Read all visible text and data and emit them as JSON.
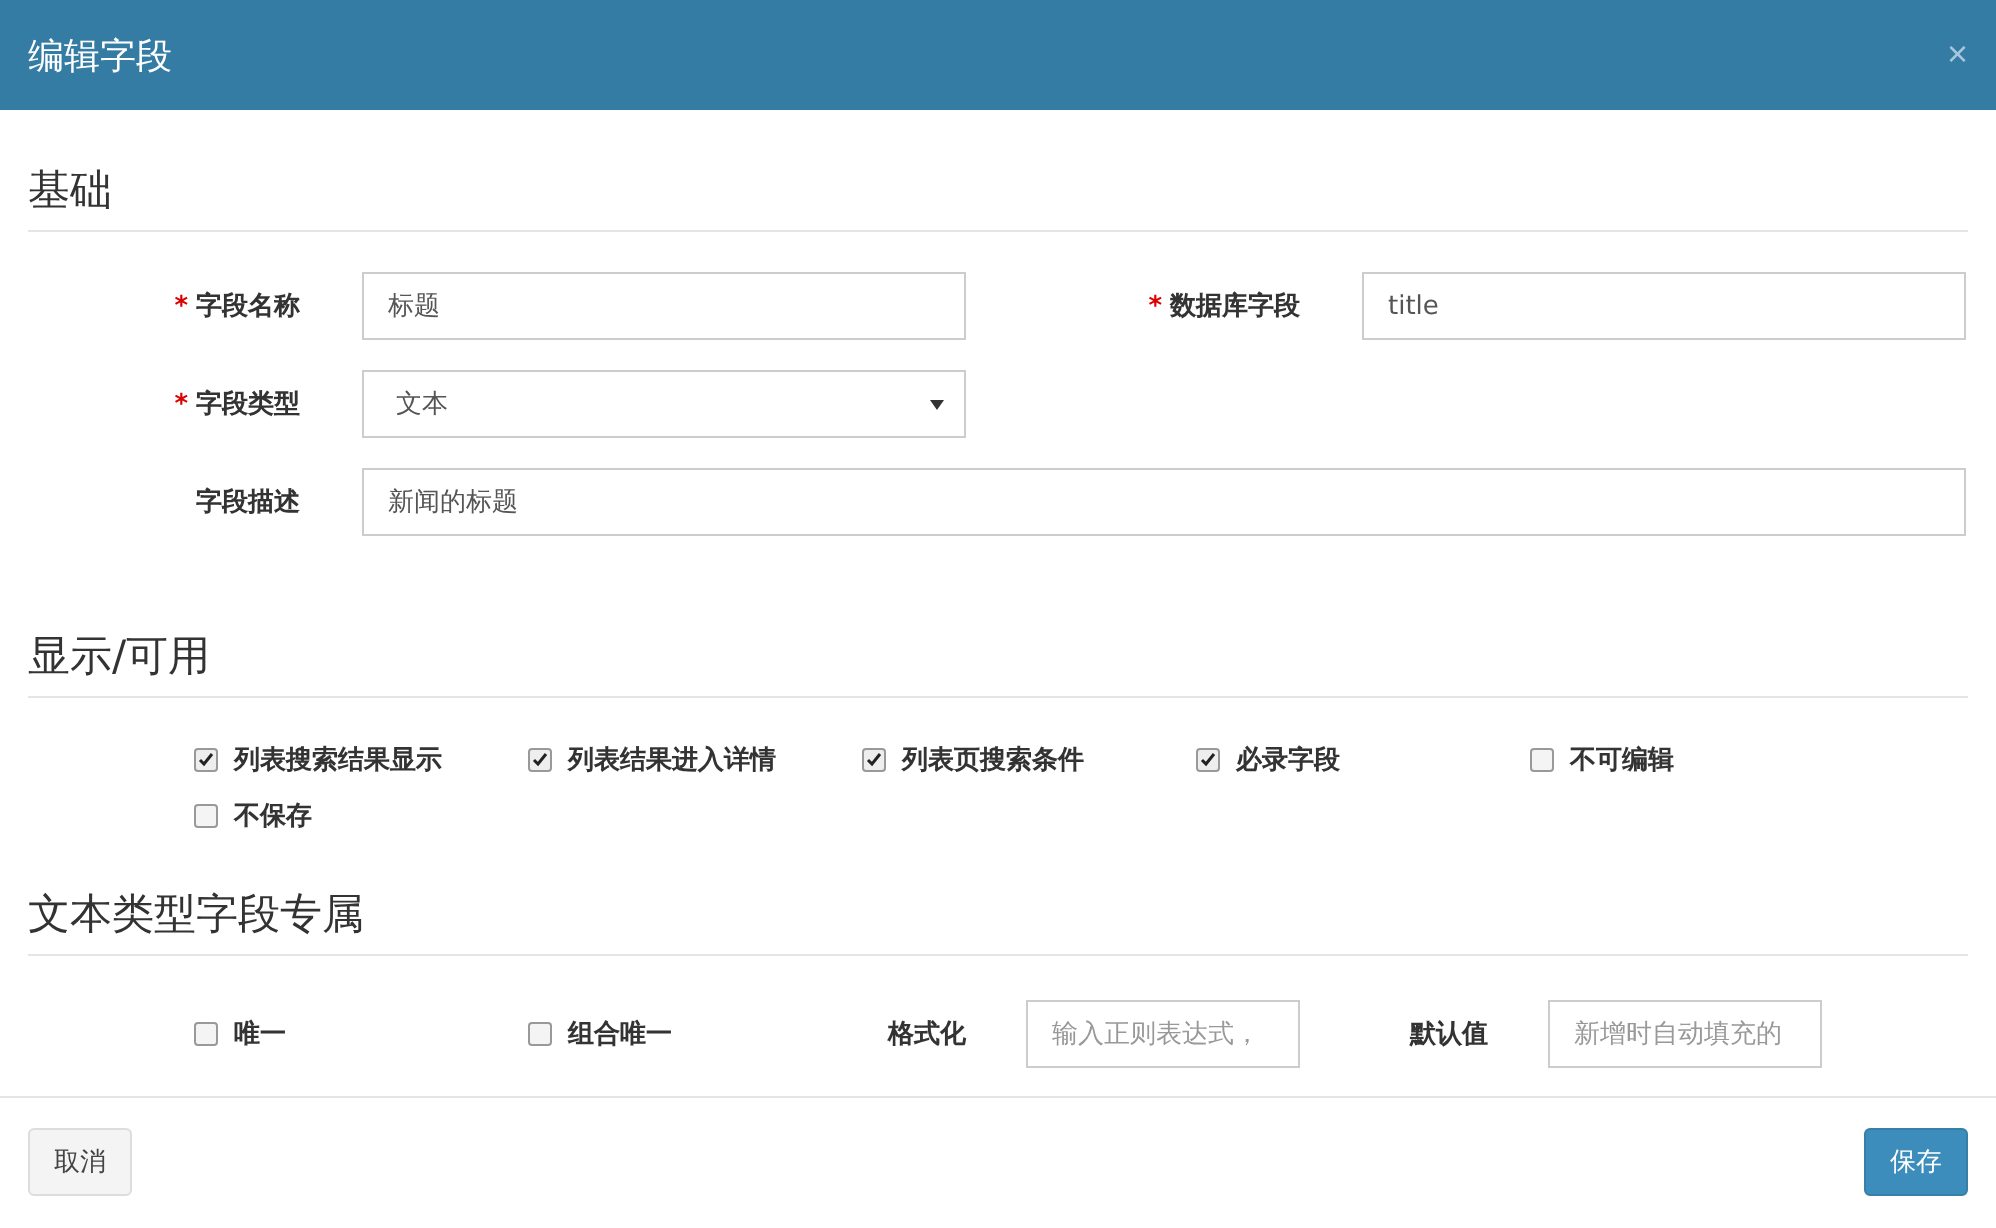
{
  "dialog": {
    "title": "编辑字段",
    "close": "×"
  },
  "sections": [
    {
      "title": "基础",
      "kind": "form",
      "fields": [
        {
          "label": "字段名称",
          "required_mark": "*",
          "kind": "text",
          "value": "标题",
          "wide": false
        },
        {
          "label": "数据库字段",
          "required_mark": "*",
          "kind": "text",
          "value": "title",
          "wide": false
        },
        {
          "label": "字段类型",
          "required_mark": "*",
          "kind": "select",
          "value": "文本",
          "wide": false
        },
        {
          "label": "字段描述",
          "kind": "text",
          "value": "新闻的标题",
          "wide": true
        }
      ]
    },
    {
      "title": "显示/可用",
      "kind": "checks",
      "items": [
        {
          "kind": "checkbox",
          "label": "列表搜索结果显示",
          "checked": true
        },
        {
          "kind": "checkbox",
          "label": "列表结果进入详情",
          "checked": true
        },
        {
          "kind": "checkbox",
          "label": "列表页搜索条件",
          "checked": true
        },
        {
          "kind": "checkbox",
          "label": "必录字段",
          "checked": true
        },
        {
          "kind": "checkbox",
          "label": "不可编辑",
          "checked": false
        },
        {
          "kind": "checkbox",
          "label": "不保存",
          "checked": false
        }
      ]
    },
    {
      "title": "文本类型字段专属",
      "kind": "checks",
      "items": [
        {
          "kind": "checkbox",
          "label": "唯一",
          "checked": false
        },
        {
          "kind": "checkbox",
          "label": "组合唯一",
          "checked": false
        },
        {
          "kind": "input",
          "label": "格式化",
          "placeholder": "输入正则表达式，"
        },
        {
          "kind": "input",
          "label": "默认值",
          "placeholder": "新增时自动填充的"
        }
      ]
    }
  ],
  "footer": {
    "cancel": "取消",
    "save": "保存"
  }
}
